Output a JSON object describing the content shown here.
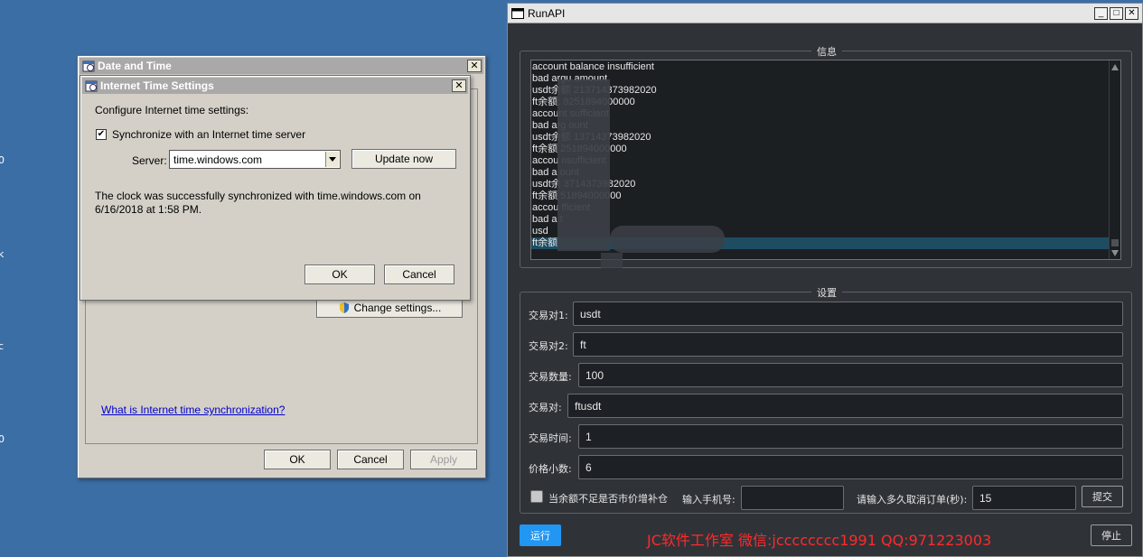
{
  "desktop": {
    "edge_labels": [
      "0",
      "k",
      "c",
      "0"
    ]
  },
  "date_time_dialog": {
    "title": "Date and Time",
    "change_settings_label": "Change settings...",
    "help_link": "What is Internet time synchronization?",
    "ok_label": "OK",
    "cancel_label": "Cancel",
    "apply_label": "Apply"
  },
  "internet_time_dialog": {
    "title": "Internet Time Settings",
    "heading": "Configure Internet time settings:",
    "sync_checkbox_label": "Synchronize with an Internet time server",
    "sync_checked": true,
    "server_label": "Server:",
    "server_value": "time.windows.com",
    "update_now_label": "Update now",
    "status_line1": "The clock was successfully synchronized with time.windows.com on",
    "status_line2": "6/16/2018 at 1:58 PM.",
    "ok_label": "OK",
    "cancel_label": "Cancel"
  },
  "runapi": {
    "title": "RunAPI",
    "info_group_title": "信息",
    "log_lines": [
      "account balance insufficient",
      "bad argu          amount",
      "usdt余额          213714373982020",
      "ft余额:           8251894000000",
      "account           sufficient",
      "bad arg           ount",
      "usdt余额          13714373982020",
      "ft余额            251894000000",
      "accou             nsufficient",
      "bad a             ount",
      "usdt余            3714373982020",
      "ft余额            51894000000",
      "accou             fficient",
      "bad a             t",
      "usd",
      "ft余额"
    ],
    "settings_group_title": "设置",
    "fields": {
      "pair1_label": "交易对1:",
      "pair1_value": "usdt",
      "pair2_label": "交易对2:",
      "pair2_value": "ft",
      "qty_label": "交易数量:",
      "qty_value": "100",
      "pair_label": "交易对:",
      "pair_value": "ftusdt",
      "time_label": "交易时间:",
      "time_value": "1",
      "decimals_label": "价格小数:",
      "decimals_value": "6"
    },
    "market_checkbox_label": "当余额不足是否市价增补仓",
    "phone_label": "输入手机号:",
    "phone_value": "",
    "cancel_secs_label": "请输入多久取消订单(秒):",
    "cancel_secs_value": "15",
    "submit_label": "提交",
    "run_label": "运行",
    "stop_label": "停止",
    "watermark": "JC软件工作室 微信:jcccccccc1991 QQ:971223003"
  },
  "colors": {
    "accent_blue": "#2196f3",
    "watermark_red": "#ff2a2a",
    "desktop_blue": "#3b6ea5"
  }
}
